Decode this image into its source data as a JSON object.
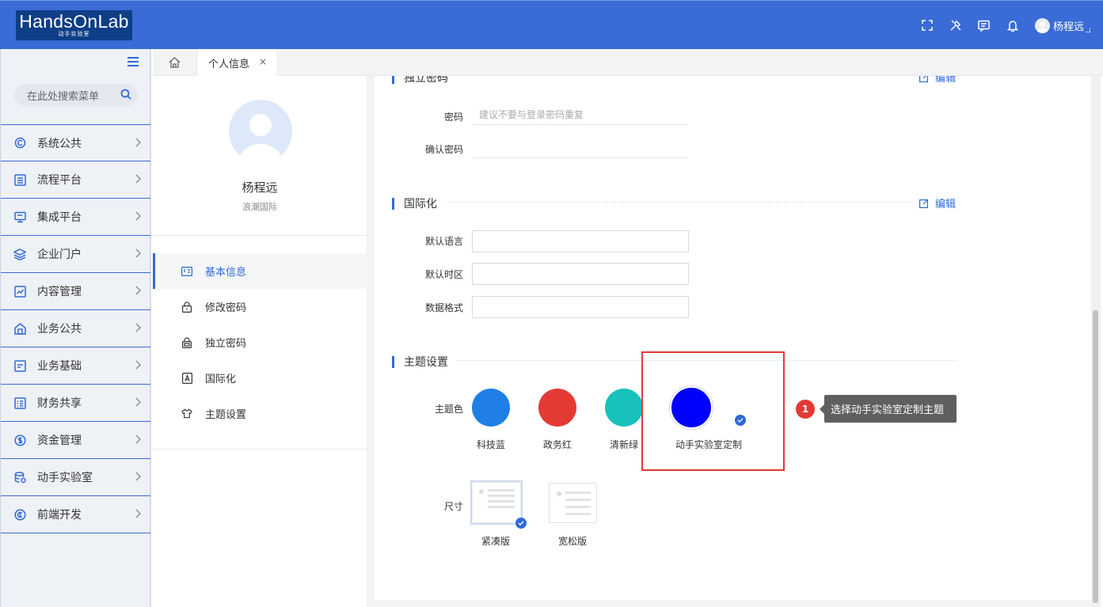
{
  "header": {
    "logo_text": "HandsOnLab",
    "logo_sub": "动手实验室",
    "user_name": "杨程远",
    "icons": [
      "fullscreen-icon",
      "tools-icon",
      "message-icon",
      "bell-icon"
    ]
  },
  "sidebar": {
    "search_placeholder": "在此处搜索菜单",
    "items": [
      {
        "label": "系统公共",
        "icon": "system-icon"
      },
      {
        "label": "流程平台",
        "icon": "process-icon"
      },
      {
        "label": "集成平台",
        "icon": "monitor-icon"
      },
      {
        "label": "企业门户",
        "icon": "layers-icon"
      },
      {
        "label": "内容管理",
        "icon": "chart-icon"
      },
      {
        "label": "业务公共",
        "icon": "house-icon"
      },
      {
        "label": "业务基础",
        "icon": "card-icon"
      },
      {
        "label": "财务共享",
        "icon": "list-icon"
      },
      {
        "label": "资金管理",
        "icon": "dollar-icon"
      },
      {
        "label": "动手实验室",
        "icon": "database-icon"
      },
      {
        "label": "前端开发",
        "icon": "code-icon"
      }
    ]
  },
  "tabs": {
    "active_label": "个人信息",
    "close_glyph": "×"
  },
  "profile": {
    "name": "杨程远",
    "org": "浪潮国际",
    "menu": [
      {
        "label": "基本信息",
        "icon": "id-card-icon",
        "active": true
      },
      {
        "label": "修改密码",
        "icon": "lock-icon",
        "active": false
      },
      {
        "label": "独立密码",
        "icon": "safe-icon",
        "active": false
      },
      {
        "label": "国际化",
        "icon": "translate-icon",
        "active": false
      },
      {
        "label": "主题设置",
        "icon": "shirt-icon",
        "active": false
      }
    ]
  },
  "sections": {
    "independent_password": {
      "title": "独立密码",
      "edit_label": "编辑",
      "fields": [
        {
          "label": "密码",
          "placeholder": "建议不要与登录密码重复",
          "value": ""
        },
        {
          "label": "确认密码",
          "placeholder": "",
          "value": ""
        }
      ]
    },
    "i18n": {
      "title": "国际化",
      "edit_label": "编辑",
      "fields": [
        {
          "label": "默认语言",
          "value": ""
        },
        {
          "label": "默认时区",
          "value": ""
        },
        {
          "label": "数据格式",
          "value": ""
        }
      ]
    },
    "theme": {
      "title": "主题设置",
      "color_label": "主题色",
      "colors": [
        {
          "name": "科技蓝",
          "color": "#1f7fe6",
          "selected": false
        },
        {
          "name": "政务红",
          "color": "#e53935",
          "selected": false
        },
        {
          "name": "清新绿",
          "color": "#18c1bb",
          "selected": false
        },
        {
          "name": "动手实验室定制",
          "color": "#0000ff",
          "selected": true
        }
      ],
      "size_label": "尺寸",
      "sizes": [
        {
          "name": "紧凑版",
          "selected": true
        },
        {
          "name": "宽松版",
          "selected": false
        }
      ]
    }
  },
  "guide": {
    "step": "1",
    "tooltip": "选择动手实验室定制主题"
  },
  "accent_color": "#3a6bd6"
}
